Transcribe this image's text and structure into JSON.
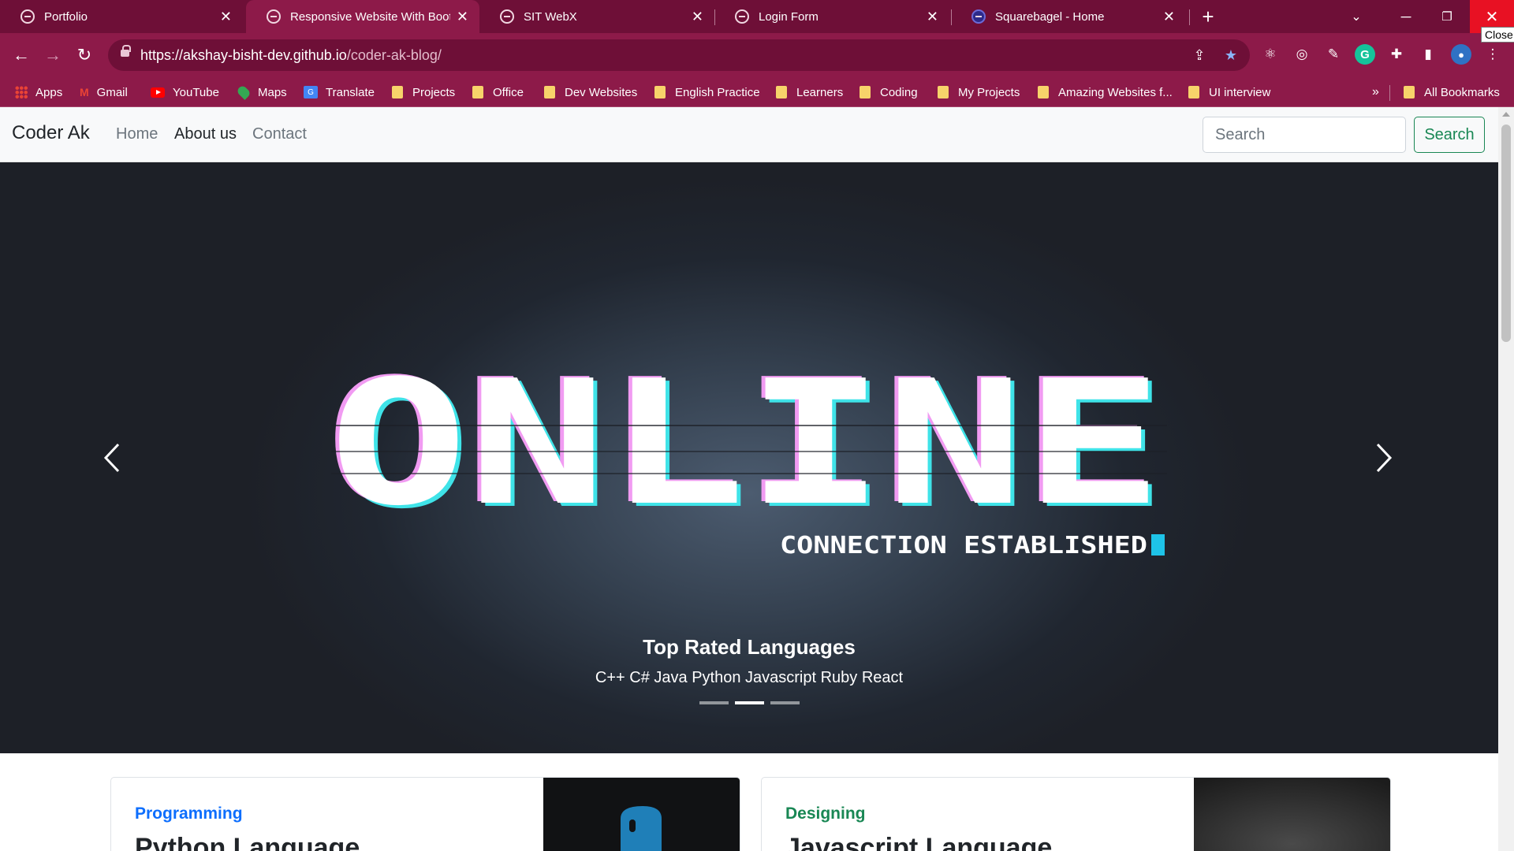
{
  "browser": {
    "tabs": [
      {
        "title": "Portfolio",
        "active": false
      },
      {
        "title": "Responsive Website With Bootst",
        "active": true
      },
      {
        "title": "SIT WebX",
        "active": false
      },
      {
        "title": "Login Form",
        "active": false
      },
      {
        "title": "Squarebagel - Home",
        "active": false
      }
    ],
    "close_tooltip": "Close",
    "url_host": "https://akshay-bisht-dev.github.io",
    "url_path": "/coder-ak-blog/",
    "bookmarks": [
      {
        "label": "Apps",
        "icon": "apps-grid-icon"
      },
      {
        "label": "Gmail",
        "icon": "gmail-icon"
      },
      {
        "label": "YouTube",
        "icon": "youtube-icon"
      },
      {
        "label": "Maps",
        "icon": "maps-pin-icon"
      },
      {
        "label": "Translate",
        "icon": "translate-icon"
      },
      {
        "label": "Projects",
        "icon": "folder-icon"
      },
      {
        "label": "Office",
        "icon": "folder-icon"
      },
      {
        "label": "Dev Websites",
        "icon": "folder-icon"
      },
      {
        "label": "English Practice",
        "icon": "folder-icon"
      },
      {
        "label": "Learners",
        "icon": "folder-icon"
      },
      {
        "label": "Coding",
        "icon": "folder-icon"
      },
      {
        "label": "My Projects",
        "icon": "folder-icon"
      },
      {
        "label": "Amazing Websites f...",
        "icon": "folder-icon"
      },
      {
        "label": "UI interview",
        "icon": "folder-icon"
      }
    ],
    "more_bookmarks": "»",
    "all_bookmarks": "All Bookmarks"
  },
  "site": {
    "brand": "Coder Ak",
    "nav": {
      "home": "Home",
      "about": "About us",
      "contact": "Contact"
    },
    "search_placeholder": "Search",
    "search_button": "Search"
  },
  "carousel": {
    "art_title": "ONLINE",
    "art_subtitle": "CONNECTION ESTABLISHED",
    "caption_title": "Top Rated Languages",
    "caption_text": "C++ C# Java Python Javascript Ruby React",
    "slide_count": 3,
    "active_slide": 2
  },
  "cards": [
    {
      "category": "Programming",
      "title": "Python Language",
      "category_color": "#0d6efd"
    },
    {
      "category": "Designing",
      "title": "Javascript Language",
      "category_color": "#198754"
    }
  ],
  "colors": {
    "tabbar": "#6e0f37",
    "toolbar": "#8d1a49",
    "accent_success": "#198754",
    "accent_primary": "#0d6efd"
  }
}
